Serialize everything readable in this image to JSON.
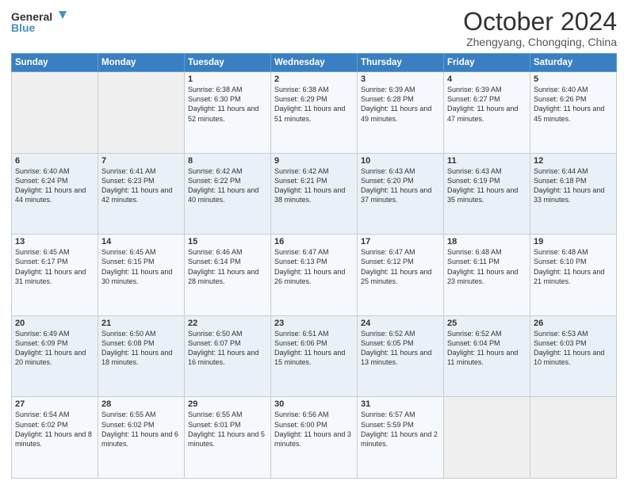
{
  "header": {
    "logo_line1": "General",
    "logo_line2": "Blue",
    "month_title": "October 2024",
    "location": "Zhengyang, Chongqing, China"
  },
  "days_of_week": [
    "Sunday",
    "Monday",
    "Tuesday",
    "Wednesday",
    "Thursday",
    "Friday",
    "Saturday"
  ],
  "weeks": [
    [
      {
        "day": "",
        "info": ""
      },
      {
        "day": "",
        "info": ""
      },
      {
        "day": "1",
        "info": "Sunrise: 6:38 AM\nSunset: 6:30 PM\nDaylight: 11 hours and 52 minutes."
      },
      {
        "day": "2",
        "info": "Sunrise: 6:38 AM\nSunset: 6:29 PM\nDaylight: 11 hours and 51 minutes."
      },
      {
        "day": "3",
        "info": "Sunrise: 6:39 AM\nSunset: 6:28 PM\nDaylight: 11 hours and 49 minutes."
      },
      {
        "day": "4",
        "info": "Sunrise: 6:39 AM\nSunset: 6:27 PM\nDaylight: 11 hours and 47 minutes."
      },
      {
        "day": "5",
        "info": "Sunrise: 6:40 AM\nSunset: 6:26 PM\nDaylight: 11 hours and 45 minutes."
      }
    ],
    [
      {
        "day": "6",
        "info": "Sunrise: 6:40 AM\nSunset: 6:24 PM\nDaylight: 11 hours and 44 minutes."
      },
      {
        "day": "7",
        "info": "Sunrise: 6:41 AM\nSunset: 6:23 PM\nDaylight: 11 hours and 42 minutes."
      },
      {
        "day": "8",
        "info": "Sunrise: 6:42 AM\nSunset: 6:22 PM\nDaylight: 11 hours and 40 minutes."
      },
      {
        "day": "9",
        "info": "Sunrise: 6:42 AM\nSunset: 6:21 PM\nDaylight: 11 hours and 38 minutes."
      },
      {
        "day": "10",
        "info": "Sunrise: 6:43 AM\nSunset: 6:20 PM\nDaylight: 11 hours and 37 minutes."
      },
      {
        "day": "11",
        "info": "Sunrise: 6:43 AM\nSunset: 6:19 PM\nDaylight: 11 hours and 35 minutes."
      },
      {
        "day": "12",
        "info": "Sunrise: 6:44 AM\nSunset: 6:18 PM\nDaylight: 11 hours and 33 minutes."
      }
    ],
    [
      {
        "day": "13",
        "info": "Sunrise: 6:45 AM\nSunset: 6:17 PM\nDaylight: 11 hours and 31 minutes."
      },
      {
        "day": "14",
        "info": "Sunrise: 6:45 AM\nSunset: 6:15 PM\nDaylight: 11 hours and 30 minutes."
      },
      {
        "day": "15",
        "info": "Sunrise: 6:46 AM\nSunset: 6:14 PM\nDaylight: 11 hours and 28 minutes."
      },
      {
        "day": "16",
        "info": "Sunrise: 6:47 AM\nSunset: 6:13 PM\nDaylight: 11 hours and 26 minutes."
      },
      {
        "day": "17",
        "info": "Sunrise: 6:47 AM\nSunset: 6:12 PM\nDaylight: 11 hours and 25 minutes."
      },
      {
        "day": "18",
        "info": "Sunrise: 6:48 AM\nSunset: 6:11 PM\nDaylight: 11 hours and 23 minutes."
      },
      {
        "day": "19",
        "info": "Sunrise: 6:48 AM\nSunset: 6:10 PM\nDaylight: 11 hours and 21 minutes."
      }
    ],
    [
      {
        "day": "20",
        "info": "Sunrise: 6:49 AM\nSunset: 6:09 PM\nDaylight: 11 hours and 20 minutes."
      },
      {
        "day": "21",
        "info": "Sunrise: 6:50 AM\nSunset: 6:08 PM\nDaylight: 11 hours and 18 minutes."
      },
      {
        "day": "22",
        "info": "Sunrise: 6:50 AM\nSunset: 6:07 PM\nDaylight: 11 hours and 16 minutes."
      },
      {
        "day": "23",
        "info": "Sunrise: 6:51 AM\nSunset: 6:06 PM\nDaylight: 11 hours and 15 minutes."
      },
      {
        "day": "24",
        "info": "Sunrise: 6:52 AM\nSunset: 6:05 PM\nDaylight: 11 hours and 13 minutes."
      },
      {
        "day": "25",
        "info": "Sunrise: 6:52 AM\nSunset: 6:04 PM\nDaylight: 11 hours and 11 minutes."
      },
      {
        "day": "26",
        "info": "Sunrise: 6:53 AM\nSunset: 6:03 PM\nDaylight: 11 hours and 10 minutes."
      }
    ],
    [
      {
        "day": "27",
        "info": "Sunrise: 6:54 AM\nSunset: 6:02 PM\nDaylight: 11 hours and 8 minutes."
      },
      {
        "day": "28",
        "info": "Sunrise: 6:55 AM\nSunset: 6:02 PM\nDaylight: 11 hours and 6 minutes."
      },
      {
        "day": "29",
        "info": "Sunrise: 6:55 AM\nSunset: 6:01 PM\nDaylight: 11 hours and 5 minutes."
      },
      {
        "day": "30",
        "info": "Sunrise: 6:56 AM\nSunset: 6:00 PM\nDaylight: 11 hours and 3 minutes."
      },
      {
        "day": "31",
        "info": "Sunrise: 6:57 AM\nSunset: 5:59 PM\nDaylight: 11 hours and 2 minutes."
      },
      {
        "day": "",
        "info": ""
      },
      {
        "day": "",
        "info": ""
      }
    ]
  ]
}
